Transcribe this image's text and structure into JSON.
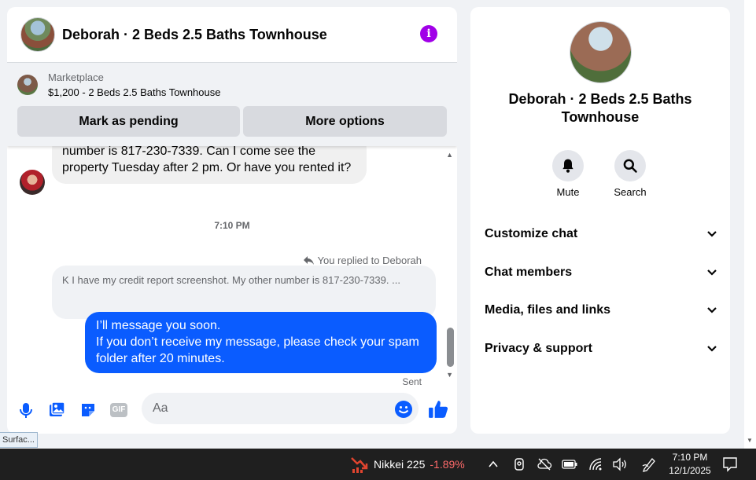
{
  "chat": {
    "title": "Deborah · 2 Beds 2.5 Baths Townhouse",
    "listing": {
      "category": "Marketplace",
      "price_title": "$1,200 - 2 Beds 2.5 Baths Townhouse",
      "mark_pending_label": "Mark as pending",
      "more_options_label": "More options"
    },
    "incoming_message": "number is 817-230-7339. Can I come see the property Tuesday after 2 pm. Or have you rented it?",
    "timestamp": "7:10 PM",
    "reply_indicator": "You replied to Deborah",
    "quoted_text": "K I have my credit report screenshot.  My other number is 817-230-7339. ...",
    "outgoing_line1": "I’ll message you soon.",
    "outgoing_line2": "If you don’t receive my message, please check your spam folder after 20 minutes.",
    "sent_status": "Sent",
    "composer_placeholder": "Aa",
    "gif_label": "GIF"
  },
  "info_panel": {
    "name": "Deborah · 2 Beds 2.5 Baths Townhouse",
    "actions": [
      {
        "label": "Mute",
        "icon": "bell-icon"
      },
      {
        "label": "Search",
        "icon": "search-icon"
      }
    ],
    "sections": [
      "Customize chat",
      "Chat members",
      "Media, files and links",
      "Privacy & support"
    ]
  },
  "tooltip": "Surfac...",
  "taskbar": {
    "ticker_name": "Nikkei 225",
    "ticker_change": "-1.89%",
    "time": "7:10 PM",
    "date": "12/1/2025"
  },
  "colors": {
    "accent": "#0a5cff",
    "info_purple": "#a100e8",
    "negative": "#ff6a6a"
  }
}
